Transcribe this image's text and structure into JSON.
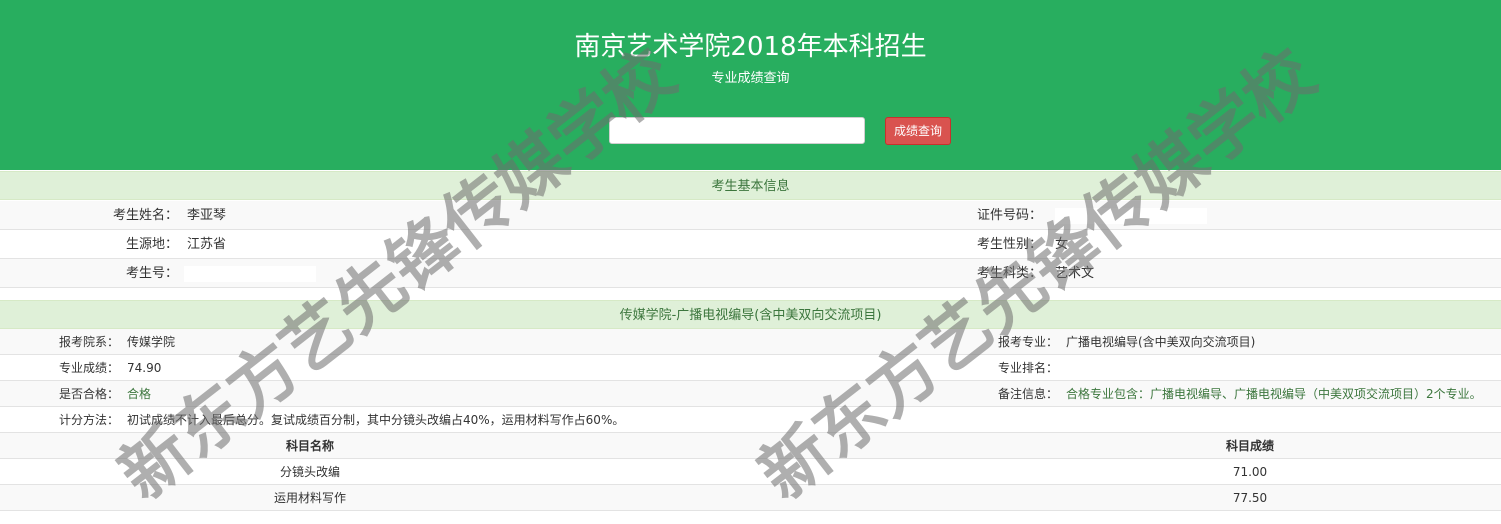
{
  "header": {
    "title": "南京艺术学院2018年本科招生",
    "subtitle": "专业成绩查询",
    "search_value": "",
    "search_button": "成绩查询"
  },
  "basic": {
    "section_title": "考生基本信息",
    "name_label": "考生姓名：",
    "name_value": "李亚琴",
    "id_label": "证件号码：",
    "origin_label": "生源地：",
    "origin_value": "江苏省",
    "gender_label": "考生性别：",
    "gender_value": "女",
    "exam_no_label": "考生号：",
    "category_label": "考生科类：",
    "category_value": "艺术文"
  },
  "major": {
    "section_title": "传媒学院-广播电视编导(含中美双向交流项目)",
    "dept_label": "报考院系：",
    "dept_value": "传媒学院",
    "major_label": "报考专业：",
    "major_value": "广播电视编导(含中美双向交流项目)",
    "score_label": "专业成绩：",
    "score_value": "74.90",
    "rank_label": "专业排名：",
    "rank_value": "",
    "pass_label": "是否合格：",
    "pass_value": "合格",
    "remark_label": "备注信息：",
    "remark_value": "合格专业包含：广播电视编导、广播电视编导（中美双项交流项目）2个专业。",
    "method_label": "计分方法：",
    "method_value": "初试成绩不计入最后总分。复试成绩百分制，其中分镜头改编占40%，运用材料写作占60%。"
  },
  "subjects": {
    "headers": [
      "科目名称",
      "科目成绩"
    ],
    "rows": [
      {
        "name": "分镜头改编",
        "score": "71.00"
      },
      {
        "name": "运用材料写作",
        "score": "77.50"
      }
    ]
  },
  "watermark": {
    "text": "新东方艺先锋传媒学校"
  },
  "colors": {
    "header_bg": "#28ae5f",
    "section_bg": "#dff0d8",
    "section_text": "#3c763d",
    "button_bg": "#d9534f"
  }
}
